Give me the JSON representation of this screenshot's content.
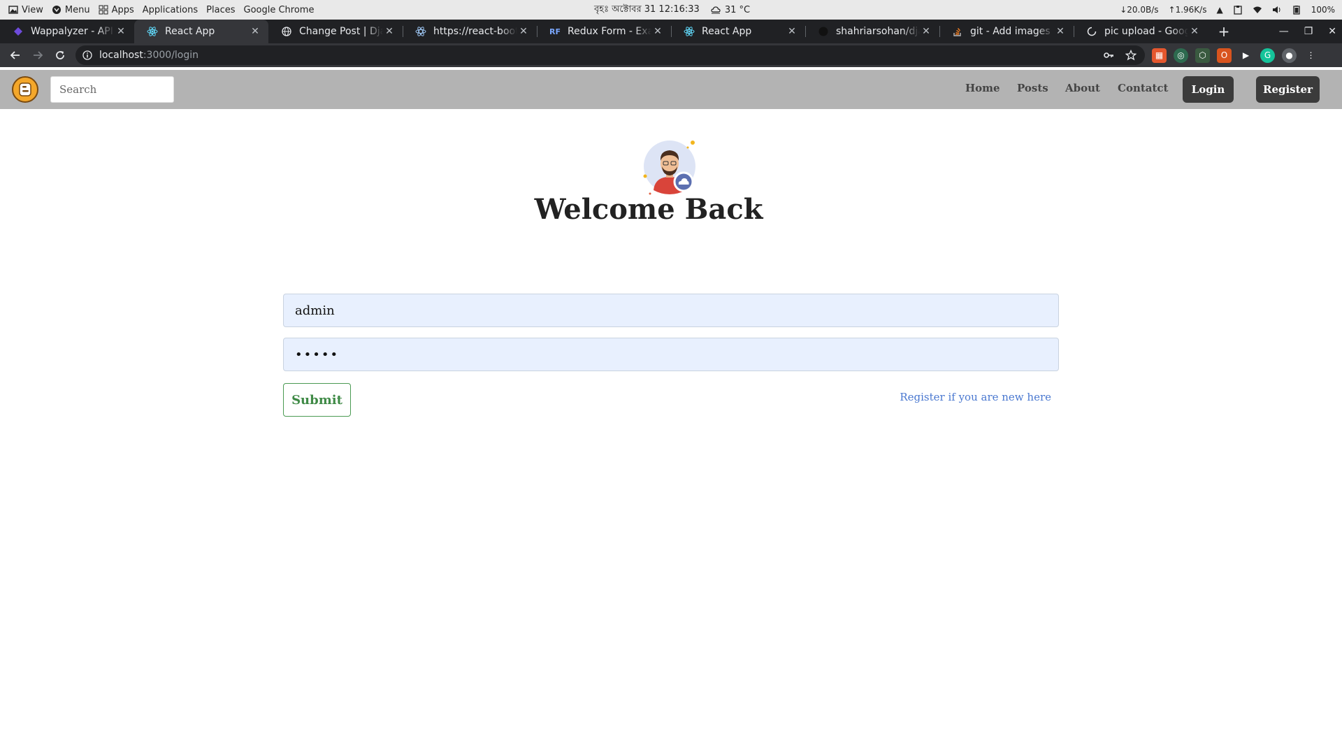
{
  "os_panel": {
    "view_label": "View",
    "menu_label": "Menu",
    "apps_label": "Apps",
    "applications_label": "Applications",
    "places_label": "Places",
    "chrome_label": "Google Chrome",
    "datetime": "বৃহঃ অক্টোবর 31  12:16:33",
    "weather": "31 °C",
    "net_down": "↓20.0B/s",
    "net_up": "↑1.96K/s",
    "battery": "100%"
  },
  "tabs": [
    {
      "title": "Wappalyzer - API",
      "favicon": "wappalyzer-icon",
      "active": false
    },
    {
      "title": "React App",
      "favicon": "react-icon",
      "active": true
    },
    {
      "title": "Change Post | Django",
      "favicon": "globe-icon",
      "active": false
    },
    {
      "title": "https://react-bootstrap",
      "favicon": "react-bootstrap-icon",
      "active": false
    },
    {
      "title": "Redux Form - Examples",
      "favicon": "redux-form-icon",
      "active": false
    },
    {
      "title": "React App",
      "favicon": "react-icon",
      "active": false
    },
    {
      "title": "shahriarsohan/django",
      "favicon": "github-icon",
      "active": false
    },
    {
      "title": "git - Add images to",
      "favicon": "stackoverflow-icon",
      "active": false
    },
    {
      "title": "pic upload - Google",
      "favicon": "loading-icon",
      "active": false
    }
  ],
  "address_bar": {
    "host": "localhost",
    "path": ":3000/login"
  },
  "site_nav": {
    "search_placeholder": "Search",
    "links": [
      "Home",
      "Posts",
      "About",
      "Contatct"
    ],
    "login_label": "Login",
    "register_label": "Register"
  },
  "login": {
    "heading": "Welcome Back",
    "username_value": "admin",
    "password_value": "•••••",
    "submit_label": "Submit",
    "register_link": "Register if you are new here"
  },
  "colors": {
    "nav_bg": "#b3b3b3",
    "input_bg": "#e8f0fe",
    "submit_green": "#3f8a46",
    "link_blue": "#4a78d0",
    "logo_orange": "#f4a72a"
  }
}
